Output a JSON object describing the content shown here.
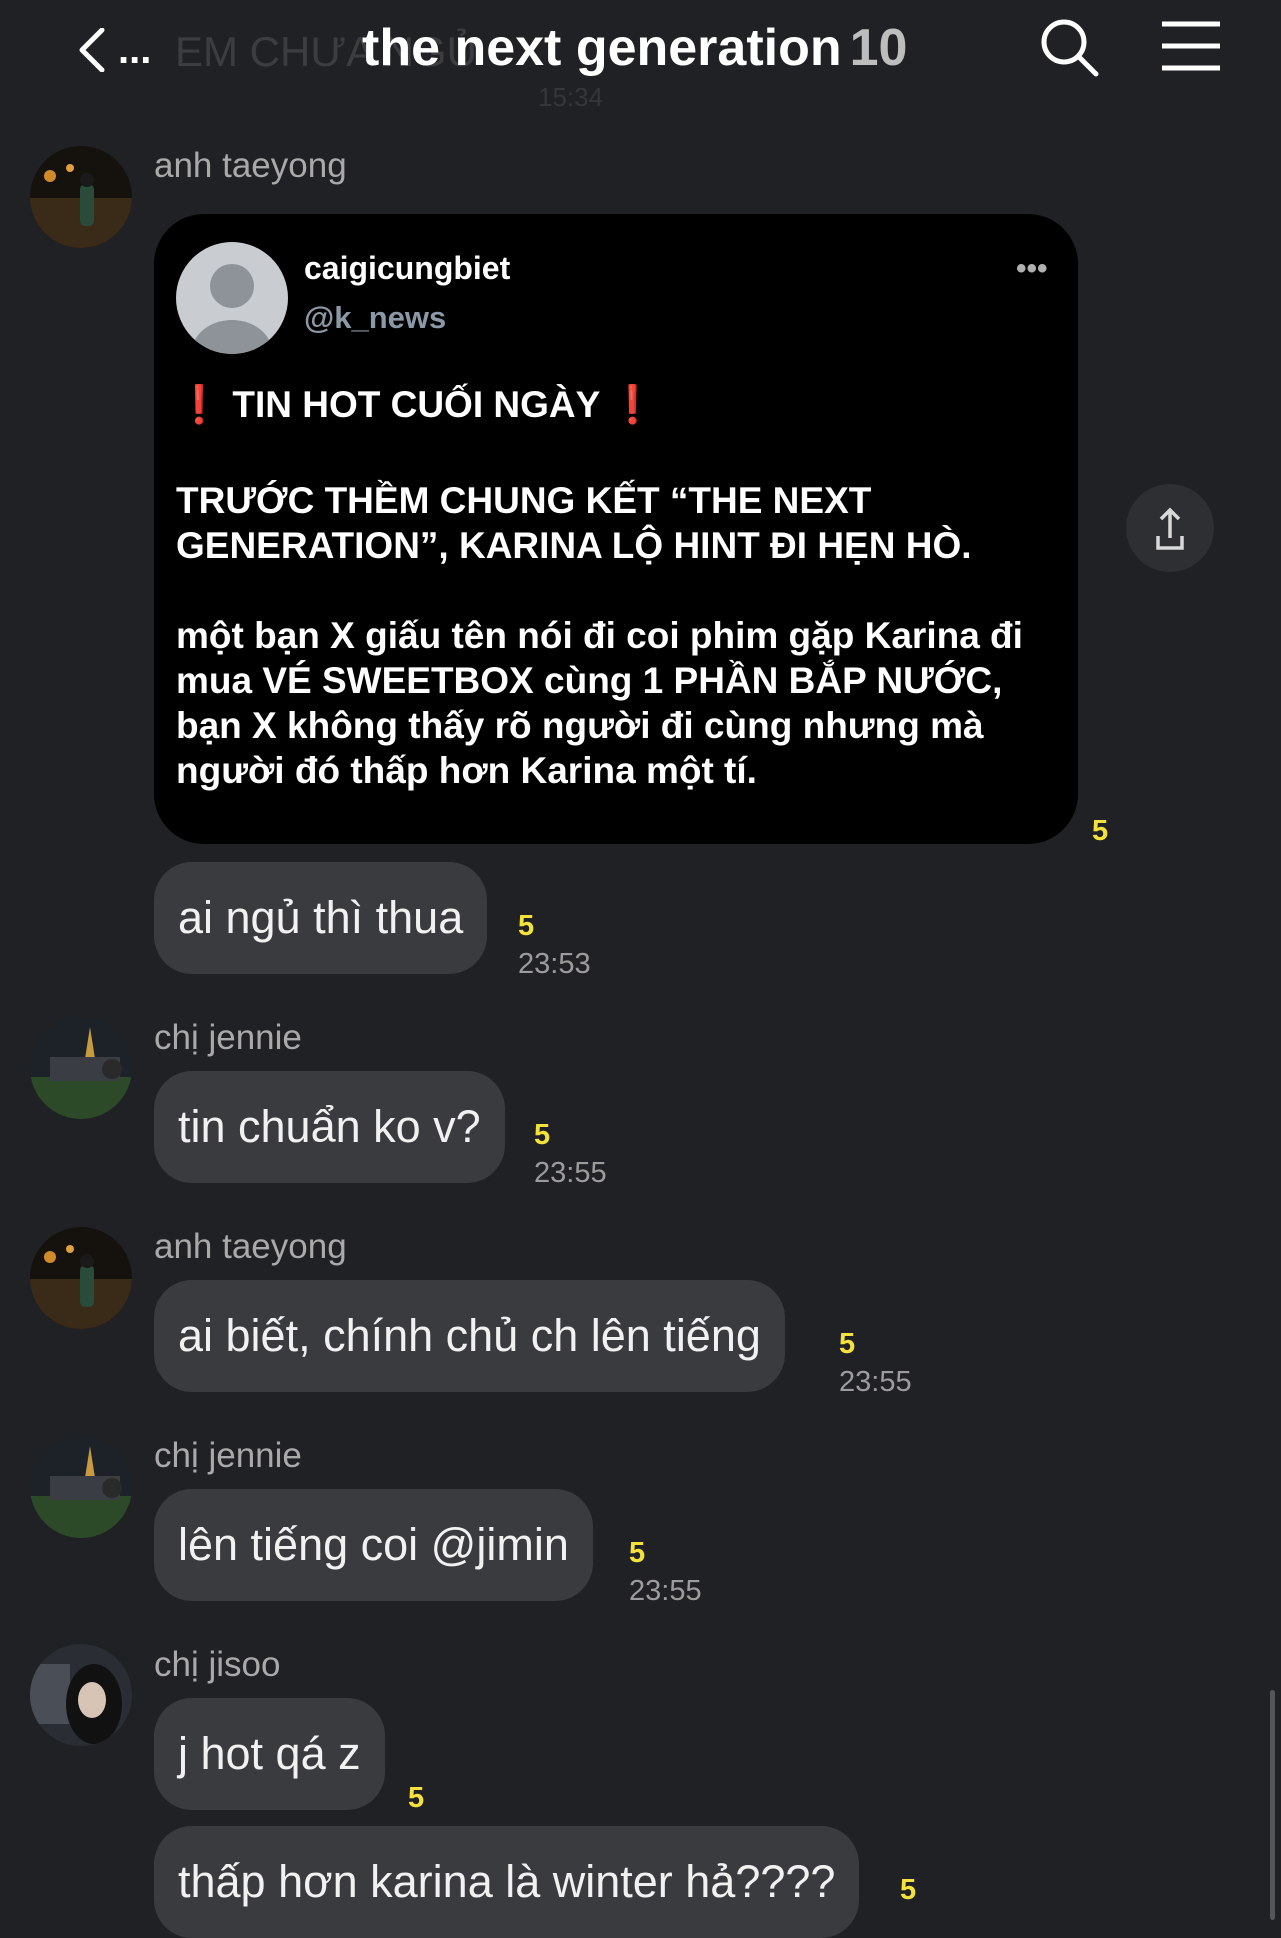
{
  "header": {
    "title": "the next generation",
    "member_count": "10",
    "back_dots": "...",
    "faded_preview": "EM CHƯA NGỦ",
    "faded_time": "15:34"
  },
  "messages": [
    {
      "sender": "anh taeyong",
      "tweet": {
        "name": "caigicungbiet",
        "handle": "@k_news",
        "more": "•••",
        "headline": "TIN HOT CUỐI NGÀY",
        "excl": "❗",
        "para1": "TRƯỚC THỀM CHUNG KẾT “THE NEXT GENERATION”, KARINA LỘ HINT ĐI HẸN HÒ.",
        "para2": "một bạn X giấu tên nói đi coi phim gặp Karina đi mua VÉ SWEETBOX cùng 1 PHẦN BẮP NƯỚC, bạn X không thấy rõ người đi cùng nhưng mà người đó thấp hơn Karina một tí."
      },
      "tweet_unread": "5",
      "text": "ai ngủ thì thua",
      "unread": "5",
      "time": "23:53"
    },
    {
      "sender": "chị jennie",
      "text": "tin chuẩn ko v?",
      "unread": "5",
      "time": "23:55"
    },
    {
      "sender": "anh taeyong",
      "text": "ai biết, chính chủ ch lên tiếng",
      "unread": "5",
      "time": "23:55"
    },
    {
      "sender": "chị jennie",
      "text": "lên tiếng coi @jimin",
      "unread": "5",
      "time": "23:55"
    },
    {
      "sender": "chị jisoo",
      "text": "j hot qá z",
      "unread": "5",
      "text2": "thấp hơn karina là winter hả????",
      "unread2": "5"
    }
  ],
  "colors": {
    "unread": "#f4e23c",
    "bubble": "#3a3b3e",
    "background": "#202124"
  }
}
